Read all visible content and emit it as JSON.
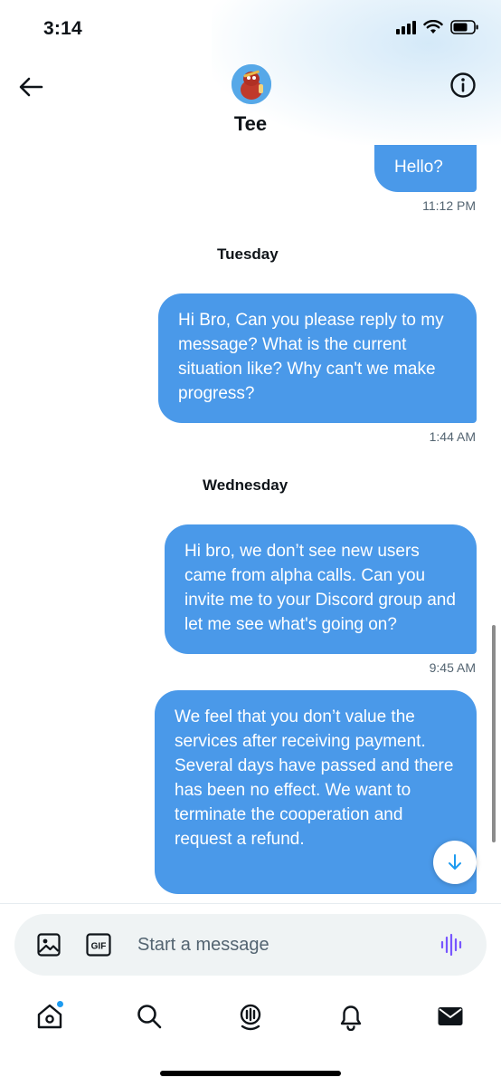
{
  "status_bar": {
    "time": "3:14"
  },
  "header": {
    "contact_name": "Tee"
  },
  "messages": [
    {
      "text": "Hello?",
      "time": "11:12 PM"
    },
    {
      "day": "Tuesday"
    },
    {
      "text": "Hi Bro, Can you please reply to my message? What is the current situation like? Why can't we make progress?",
      "time": "1:44 AM"
    },
    {
      "day": "Wednesday"
    },
    {
      "text": "Hi bro, we don’t see new users came from alpha calls. Can you invite me to your Discord group and let me see what's going on?",
      "time": "9:45 AM"
    },
    {
      "text": "We feel that you don’t value the services after receiving payment. Several days have passed and there has been no effect. We want to terminate the cooperation and request a refund.",
      "time": ""
    }
  ],
  "composer": {
    "placeholder": "Start a message",
    "gif_label": "GIF"
  },
  "colors": {
    "bubble": "#4a99e9",
    "accent": "#1d9bf0",
    "voice": "#7856ff",
    "timestamp": "#536471"
  },
  "icons": {
    "back": "arrow-left-icon",
    "info": "info-icon",
    "media": "image-icon",
    "gif": "gif-icon",
    "voice": "voice-wave-icon",
    "scroll_down": "arrow-down-icon",
    "tabs": [
      "home-icon",
      "search-icon",
      "spaces-icon",
      "bell-icon",
      "mail-icon"
    ]
  }
}
